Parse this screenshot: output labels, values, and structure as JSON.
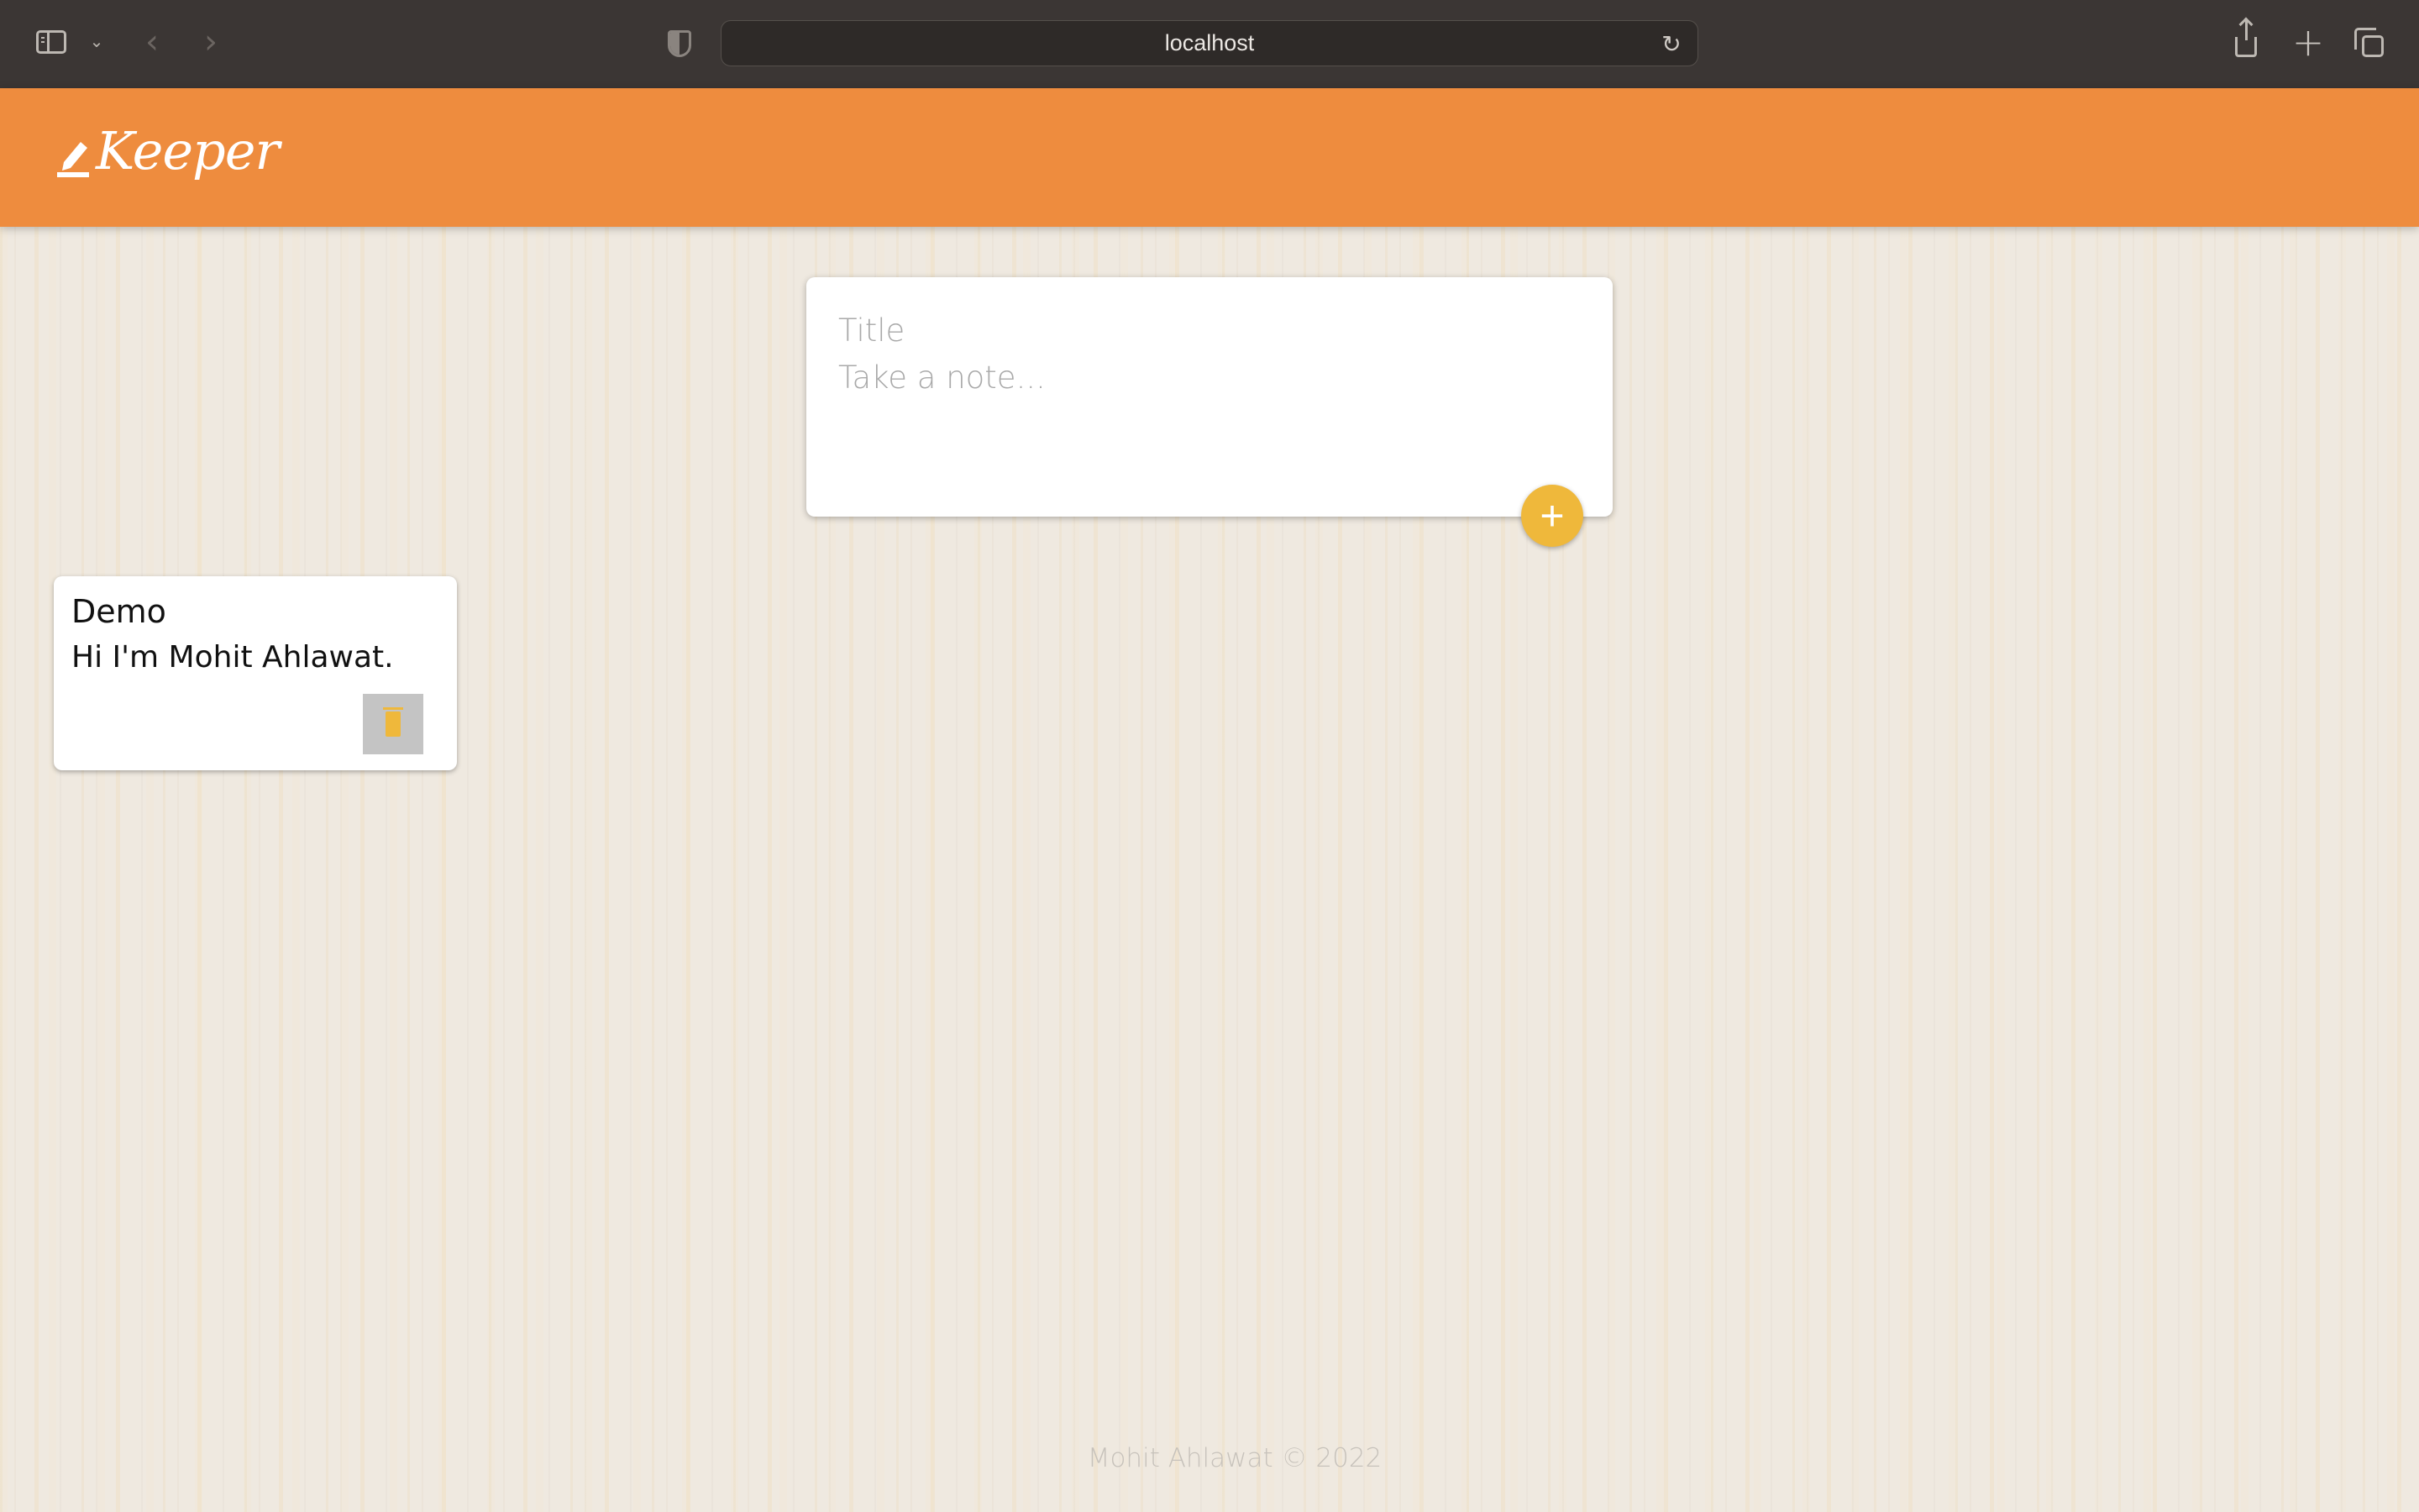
{
  "browser": {
    "url": "localhost",
    "icons": {
      "sidebar": "sidebar-toggle-icon",
      "dropdown": "chevron-down-icon",
      "back": "chevron-left-icon",
      "forward": "chevron-right-icon",
      "privacy": "shield-icon",
      "reload": "reload-icon",
      "share": "share-icon",
      "new_tab": "plus-icon",
      "tab_overview": "tabs-icon"
    }
  },
  "header": {
    "brand": "Keeper",
    "brand_icon": "pencil-icon",
    "background_color": "#ee8c3e"
  },
  "composer": {
    "title_placeholder": "Title",
    "content_placeholder": "Take a note...",
    "title_value": "",
    "content_value": "",
    "add_label": "+",
    "add_color": "#efb83b"
  },
  "notes": [
    {
      "title": "Demo",
      "content": "Hi I'm Mohit Ahlawat.",
      "delete_icon": "trash-icon"
    }
  ],
  "footer": {
    "text": "Mohit Ahlawat © 2022"
  }
}
